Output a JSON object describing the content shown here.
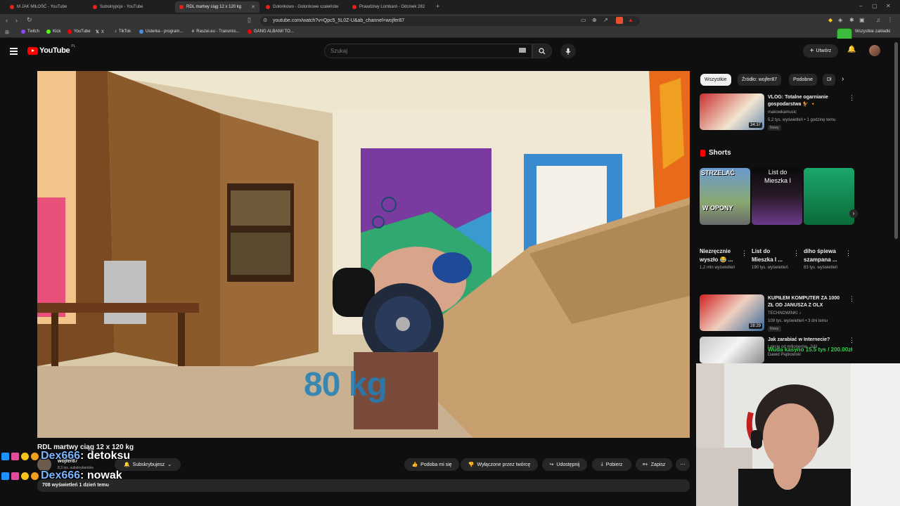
{
  "browser": {
    "tabs": [
      {
        "title": "M JAK MIŁOŚĆ - YouTube"
      },
      {
        "title": "Subskrypcje - YouTube"
      },
      {
        "title": "RDL martwy ciąg 12 x 120 kg"
      },
      {
        "title": "Gołonkowo - Gołonkowe szaleństw"
      },
      {
        "title": "Prawdziwy Lombard - Odcinek 282"
      }
    ],
    "url": "youtube.com/watch?v=Qpc5_5L0Z-U&ab_channel=wojfer87",
    "bookmarks": [
      {
        "label": "Twitch",
        "color": "#9146ff"
      },
      {
        "label": "Kick",
        "color": "#53fc18"
      },
      {
        "label": "YouTube",
        "color": "#ff0000"
      },
      {
        "label": "X",
        "color": "#ffffff"
      },
      {
        "label": "TikTok",
        "color": "#ffffff"
      },
      {
        "label": "Usterka - program...",
        "color": "#4a90d9"
      },
      {
        "label": "Raszei.eu - Transmis...",
        "color": "#cccccc"
      },
      {
        "label": "GANG ALBANII TO...",
        "color": "#ff0000"
      }
    ],
    "all_bookmarks": "Wszystkie zakładki"
  },
  "header": {
    "logo_text": "YouTube",
    "logo_region": "PL",
    "search_placeholder": "Szukaj",
    "create_label": "Utwórz"
  },
  "video": {
    "overlay_text": "80 kg",
    "title": "RDL martwy ciąg 12 x 120 kg",
    "channel": "wojfer87",
    "subscribers": "8,3 tys. subskrybentów",
    "subscribed_label": "Subskrybujesz",
    "like_label": "Podoba mi się",
    "dislike_label": "Wyłączone przez twórcę",
    "share_label": "Udostępnij",
    "download_label": "Pobierz",
    "save_label": "Zapisz",
    "views_line": "708 wyświetleń  1 dzień temu"
  },
  "chat": [
    {
      "user": "Dex666",
      "message": ": detoksu"
    },
    {
      "user": "Dex666",
      "message": ": nowak"
    }
  ],
  "sidebar": {
    "chips": [
      {
        "label": "Wszystkie"
      },
      {
        "label": "Źródło: wojfer87"
      },
      {
        "label": "Podobne"
      },
      {
        "label": "Dl"
      }
    ],
    "rec1": {
      "title_l1": "VLOG: Totalne ogarnianie",
      "title_l2": "gospodarstwa 🐓 🔸",
      "channel": "makowkamusic",
      "meta": "5,2 tys. wyświetleń • 1 godzinę temu",
      "badge": "Nowy",
      "duration": "34:37"
    },
    "shorts_heading": "Shorts",
    "shorts": [
      {
        "title": "Niezręcznie wyszło 😂 ...",
        "views": "1,2 mln wyświetleń",
        "thumb_text_top": "STRZELAĆ",
        "thumb_text_bottom": "W OPONY"
      },
      {
        "title": "List do Mieszka I ...",
        "views": "190 tys. wyświetleń",
        "thumb_text_top": "List do Mieszka I"
      },
      {
        "title": "diho śpiewa szampana ...",
        "views": "83 tys. wyświetleń"
      }
    ],
    "rec2": {
      "title_l1": "KUPIŁEM KOMPUTER ZA 1000",
      "title_l2": "ZŁ OD JANUSZA Z OLX",
      "channel": "TECHNOWINKI ♪",
      "meta": "109 tys. wyświetleń • 3 dni temu",
      "badge": "Nowy",
      "duration": "28:29"
    },
    "rec3": {
      "title_l1": "Jak zarabiać w Internecie?",
      "title_l2": "Lekcje od milionerów- Julii",
      "channel": "Dawid Piątkowski"
    }
  },
  "donation": {
    "text": "Wuda kasyno 15.5 tys / 200.00zł"
  },
  "colors": {
    "yt_red": "#ff0000",
    "bg": "#0f0f0f",
    "chip_bg": "#272727"
  }
}
